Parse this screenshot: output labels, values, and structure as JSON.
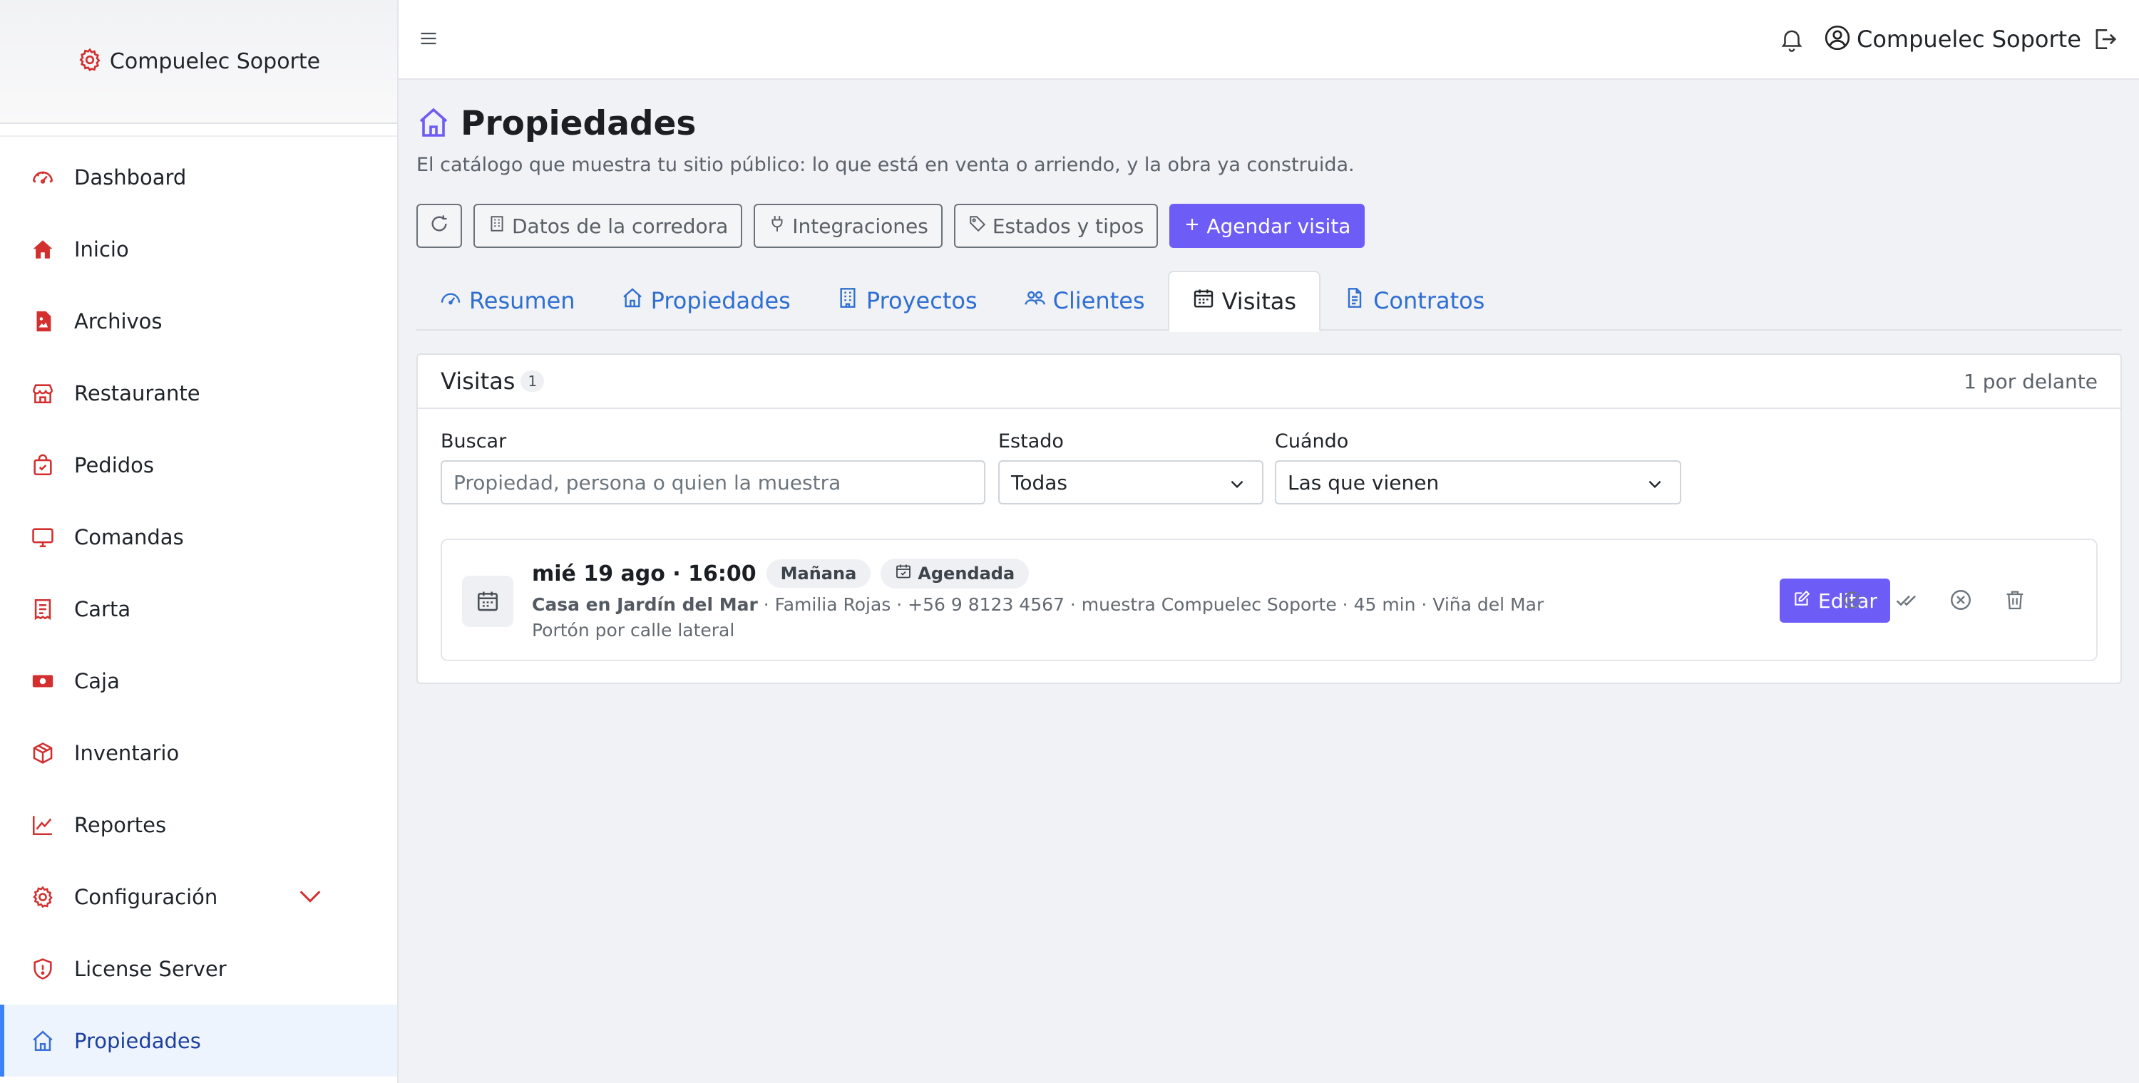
{
  "brand": {
    "name": "Compuelec Soporte",
    "accent": "#d32f2f"
  },
  "sidebar": {
    "items": [
      {
        "label": "Dashboard",
        "icon": "dashboard-icon"
      },
      {
        "label": "Inicio",
        "icon": "home-icon"
      },
      {
        "label": "Archivos",
        "icon": "file-image-icon"
      },
      {
        "label": "Restaurante",
        "icon": "shop-icon"
      },
      {
        "label": "Pedidos",
        "icon": "bag-check-icon"
      },
      {
        "label": "Comandas",
        "icon": "monitor-icon"
      },
      {
        "label": "Carta",
        "icon": "receipt-icon"
      },
      {
        "label": "Caja",
        "icon": "cash-icon"
      },
      {
        "label": "Inventario",
        "icon": "box-icon"
      },
      {
        "label": "Reportes",
        "icon": "graph-icon"
      },
      {
        "label": "Configuración",
        "icon": "gear-icon"
      },
      {
        "label": "License Server",
        "icon": "shield-icon"
      },
      {
        "label": "Propiedades",
        "icon": "house-icon",
        "active": true
      }
    ]
  },
  "topbar": {
    "user_name": "Compuelec Soporte"
  },
  "page": {
    "title": "Propiedades",
    "subtitle": "El catálogo que muestra tu sitio público: lo que está en venta o arriendo, y la obra ya construida."
  },
  "toolbar": {
    "datos": "Datos de la corredora",
    "integraciones": "Integraciones",
    "estados": "Estados y tipos",
    "agendar": "Agendar visita"
  },
  "tabs": [
    {
      "label": "Resumen"
    },
    {
      "label": "Propiedades"
    },
    {
      "label": "Proyectos"
    },
    {
      "label": "Clientes"
    },
    {
      "label": "Visitas",
      "active": true
    },
    {
      "label": "Contratos"
    }
  ],
  "visitas": {
    "title": "Visitas",
    "count": "1",
    "ahead": "1 por delante",
    "filters": {
      "search_label": "Buscar",
      "search_placeholder": "Propiedad, persona o quien la muestra",
      "estado_label": "Estado",
      "estado_value": "Todas",
      "cuando_label": "Cuándo",
      "cuando_value": "Las que vienen"
    },
    "items": [
      {
        "when": "mié 19 ago · 16:00",
        "period": "Mañana",
        "status": "Agendada",
        "property": "Casa en Jardín del Mar",
        "details": " · Familia Rojas · +56 9 8123 4567 · muestra Compuelec Soporte · 45 min · Viña del Mar",
        "note": "Portón por calle lateral",
        "edit_label": "Editar"
      }
    ]
  },
  "colors": {
    "primary": "#6d5cf6",
    "link": "#2f6fd1",
    "active_border": "#3b82f6"
  }
}
